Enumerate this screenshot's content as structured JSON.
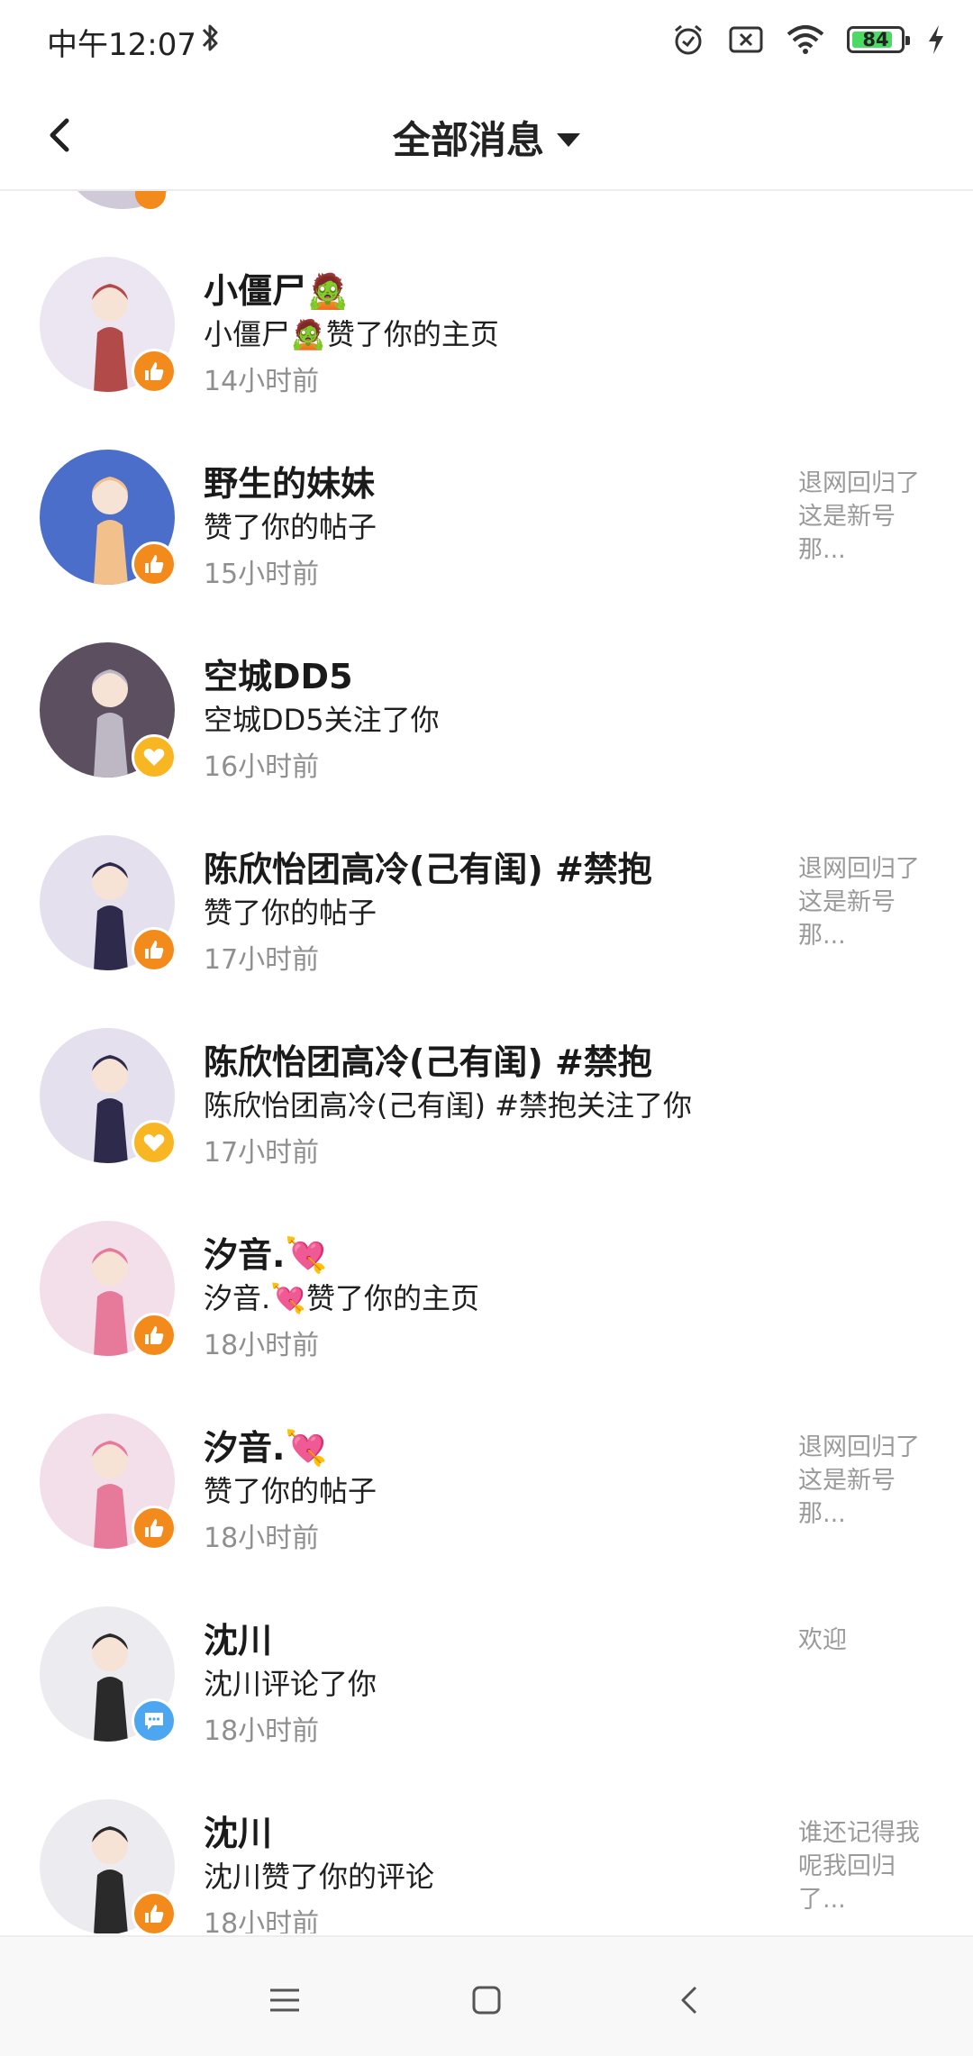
{
  "status_bar": {
    "time": "中午12:07",
    "battery_level": "84",
    "battery_fraction": 0.84,
    "icons": [
      "bluetooth-icon",
      "alarm-icon",
      "sim-off-icon",
      "wifi-icon",
      "battery-icon",
      "charging-icon"
    ]
  },
  "header": {
    "title": "全部消息",
    "back_icon": "back-arrow-icon",
    "dropdown_icon": "caret-down-icon"
  },
  "notifications": [
    {
      "name": "小僵尸🧟",
      "desc": "小僵尸🧟赞了你的主页",
      "time": "14小时前",
      "snippet": "",
      "badge": "like"
    },
    {
      "name": "野生的妹妹",
      "desc": "赞了你的帖子",
      "time": "15小时前",
      "snippet": "退网回归了\n这是新号\n那...",
      "badge": "like"
    },
    {
      "name": "空城DD5",
      "desc": "空城DD5关注了你",
      "time": "16小时前",
      "snippet": "",
      "badge": "follow"
    },
    {
      "name": "陈欣怡团高冷(己有闺) #禁抱",
      "desc": "赞了你的帖子",
      "time": "17小时前",
      "snippet": "退网回归了\n这是新号\n那...",
      "badge": "like"
    },
    {
      "name": "陈欣怡团高冷(己有闺) #禁抱",
      "desc": "陈欣怡团高冷(己有闺) #禁抱关注了你",
      "time": "17小时前",
      "snippet": "",
      "badge": "follow"
    },
    {
      "name": "汐音.💘",
      "desc": "汐音.💘赞了你的主页",
      "time": "18小时前",
      "snippet": "",
      "badge": "like"
    },
    {
      "name": "汐音.💘",
      "desc": "赞了你的帖子",
      "time": "18小时前",
      "snippet": "退网回归了\n这是新号\n那...",
      "badge": "like"
    },
    {
      "name": "沈川",
      "desc": "沈川评论了你",
      "time": "18小时前",
      "snippet": "欢迎",
      "badge": "comment"
    },
    {
      "name": "沈川",
      "desc": "沈川赞了你的评论",
      "time": "18小时前",
      "snippet": "谁还记得我\n呢我回归\n了...",
      "badge": "like"
    }
  ],
  "badge_colors": {
    "like": "#f38a1c",
    "follow": "#f8b623",
    "comment": "#4da6f0"
  },
  "nav_bar": {
    "icons": [
      "menu-icon",
      "home-square-icon",
      "back-triangle-icon"
    ]
  }
}
